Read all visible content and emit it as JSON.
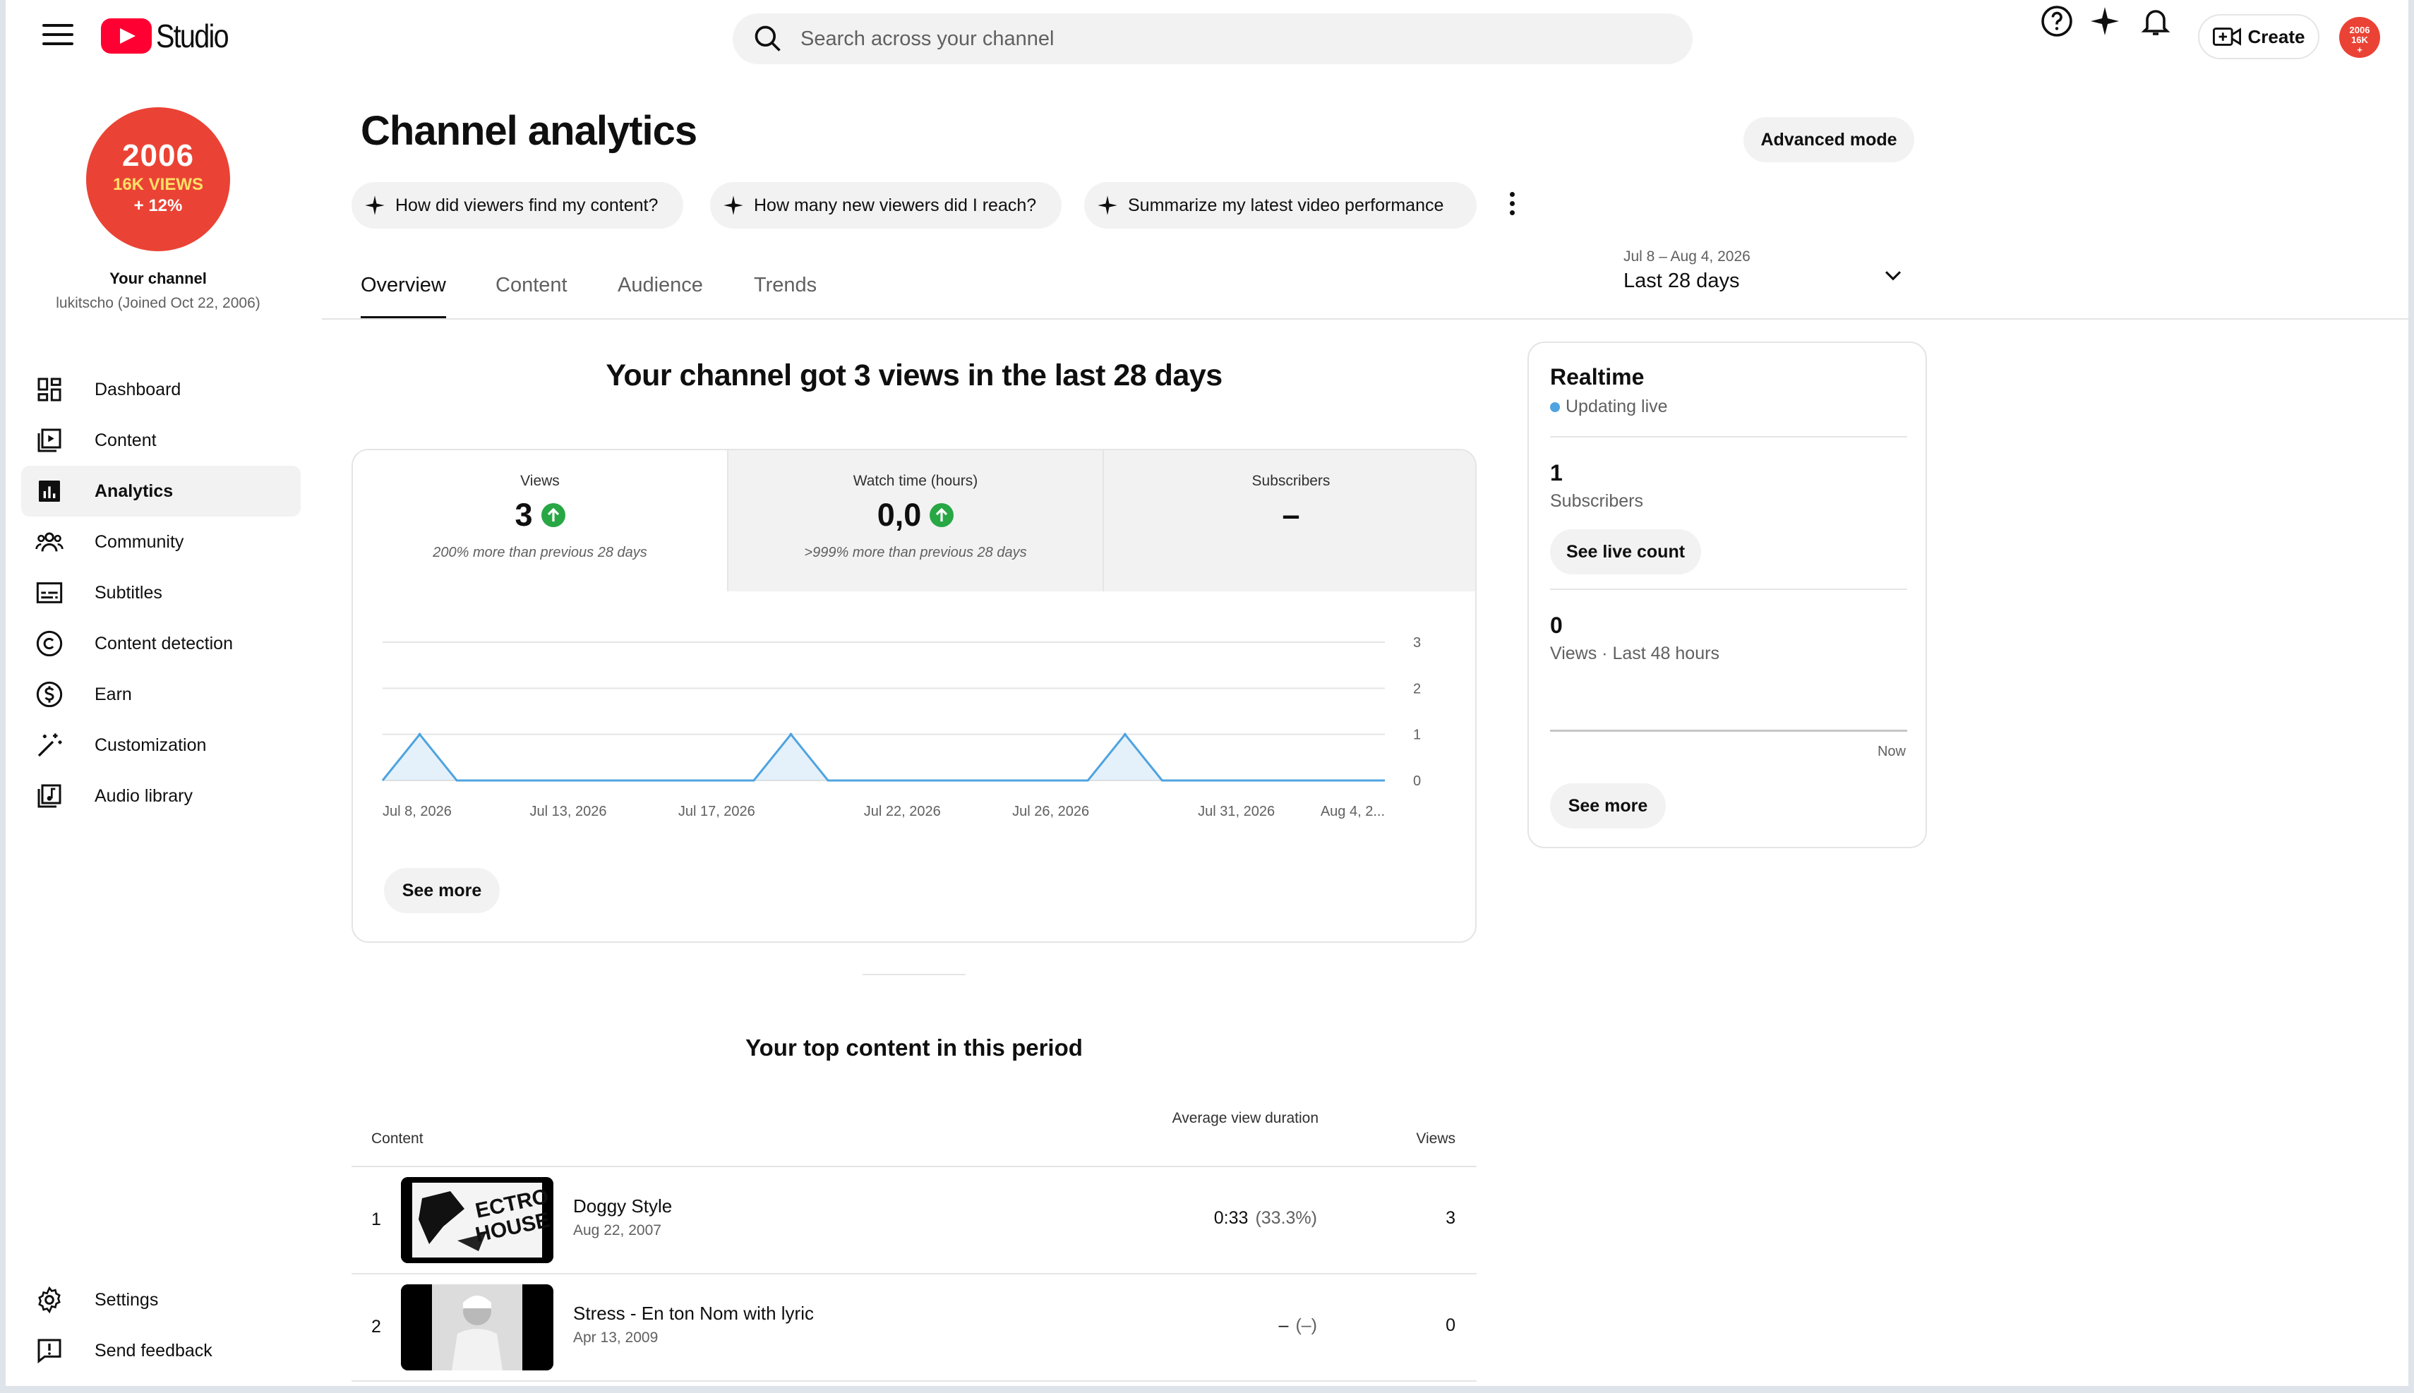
{
  "header": {
    "logo_text": "Studio",
    "search_placeholder": "Search across your channel",
    "create_label": "Create",
    "avatar_text": "2006\n16K VIEWS\n+12%"
  },
  "sidebar": {
    "avatar": {
      "line1": "2006",
      "line2": "16K VIEWS",
      "line3": "+ 12%"
    },
    "channel_title": "Your channel",
    "channel_sub": "lukitscho (Joined Oct 22, 2006)",
    "items": [
      {
        "label": "Dashboard",
        "icon": "dashboard-icon"
      },
      {
        "label": "Content",
        "icon": "content-icon"
      },
      {
        "label": "Analytics",
        "icon": "analytics-icon",
        "active": true
      },
      {
        "label": "Community",
        "icon": "community-icon"
      },
      {
        "label": "Subtitles",
        "icon": "subtitles-icon"
      },
      {
        "label": "Content detection",
        "icon": "copyright-icon"
      },
      {
        "label": "Earn",
        "icon": "earn-icon"
      },
      {
        "label": "Customization",
        "icon": "magic-wand-icon"
      },
      {
        "label": "Audio library",
        "icon": "audio-library-icon"
      }
    ],
    "bottom_items": [
      {
        "label": "Settings",
        "icon": "gear-icon"
      },
      {
        "label": "Send feedback",
        "icon": "feedback-icon"
      }
    ]
  },
  "main": {
    "title": "Channel analytics",
    "advanced_mode": "Advanced mode",
    "chips": [
      "How did viewers find my content?",
      "How many new viewers did I reach?",
      "Summarize my latest video performance"
    ],
    "tabs": [
      "Overview",
      "Content",
      "Audience",
      "Trends"
    ],
    "active_tab": "Overview",
    "date_range": {
      "dates": "Jul 8 – Aug 4, 2026",
      "label": "Last 28 days"
    },
    "headline": "Your channel got 3 views in the last 28 days",
    "metrics": [
      {
        "label": "Views",
        "value": "3",
        "note": "200% more than previous 28 days",
        "trend": "up"
      },
      {
        "label": "Watch time (hours)",
        "value": "0,0",
        "note": ">999% more than previous 28 days",
        "trend": "up"
      },
      {
        "label": "Subscribers",
        "value": "–",
        "note": ""
      }
    ],
    "see_more": "See more"
  },
  "chart_data": {
    "type": "area",
    "x": [
      "Jul 8",
      "Jul 9",
      "Jul 10",
      "Jul 11",
      "Jul 12",
      "Jul 13",
      "Jul 14",
      "Jul 15",
      "Jul 16",
      "Jul 17",
      "Jul 18",
      "Jul 19",
      "Jul 20",
      "Jul 21",
      "Jul 22",
      "Jul 23",
      "Jul 24",
      "Jul 25",
      "Jul 26",
      "Jul 27",
      "Jul 28",
      "Jul 29",
      "Jul 30",
      "Jul 31",
      "Aug 1",
      "Aug 2",
      "Aug 3",
      "Aug 4"
    ],
    "values": [
      0,
      1,
      0,
      0,
      0,
      0,
      0,
      0,
      0,
      0,
      0,
      1,
      0,
      0,
      0,
      0,
      0,
      0,
      0,
      0,
      1,
      0,
      0,
      0,
      0,
      0,
      0,
      0
    ],
    "x_tick_labels": [
      "Jul 8, 2026",
      "Jul 13, 2026",
      "Jul 17, 2026",
      "Jul 22, 2026",
      "Jul 26, 2026",
      "Jul 31, 2026",
      "Aug 4, 2..."
    ],
    "x_tick_index": [
      0,
      5,
      9,
      14,
      18,
      23,
      27
    ],
    "y_ticks": [
      0,
      1,
      2,
      3
    ],
    "ylim": [
      0,
      3
    ],
    "grid": true,
    "color": "#4fa3e0"
  },
  "realtime": {
    "title": "Realtime",
    "status": "Updating live",
    "subscribers_value": "1",
    "subscribers_label": "Subscribers",
    "live_count_button": "See live count",
    "views_value": "0",
    "views_label": "Views · Last 48 hours",
    "now_label": "Now",
    "see_more": "See more"
  },
  "top_content": {
    "title": "Your top content in this period",
    "col_content": "Content",
    "col_avg": "Average view duration",
    "col_views": "Views",
    "rows": [
      {
        "rank": "1",
        "title": "Doggy Style",
        "date": "Aug 22, 2007",
        "duration": "0:33",
        "pct": "(33.3%)",
        "views": "3",
        "thumb_text": "ELECTRO HOUSE"
      },
      {
        "rank": "2",
        "title": "Stress - En ton Nom with lyric",
        "date": "Apr 13, 2009",
        "duration": "–",
        "pct": "(–)",
        "views": "0"
      }
    ]
  }
}
